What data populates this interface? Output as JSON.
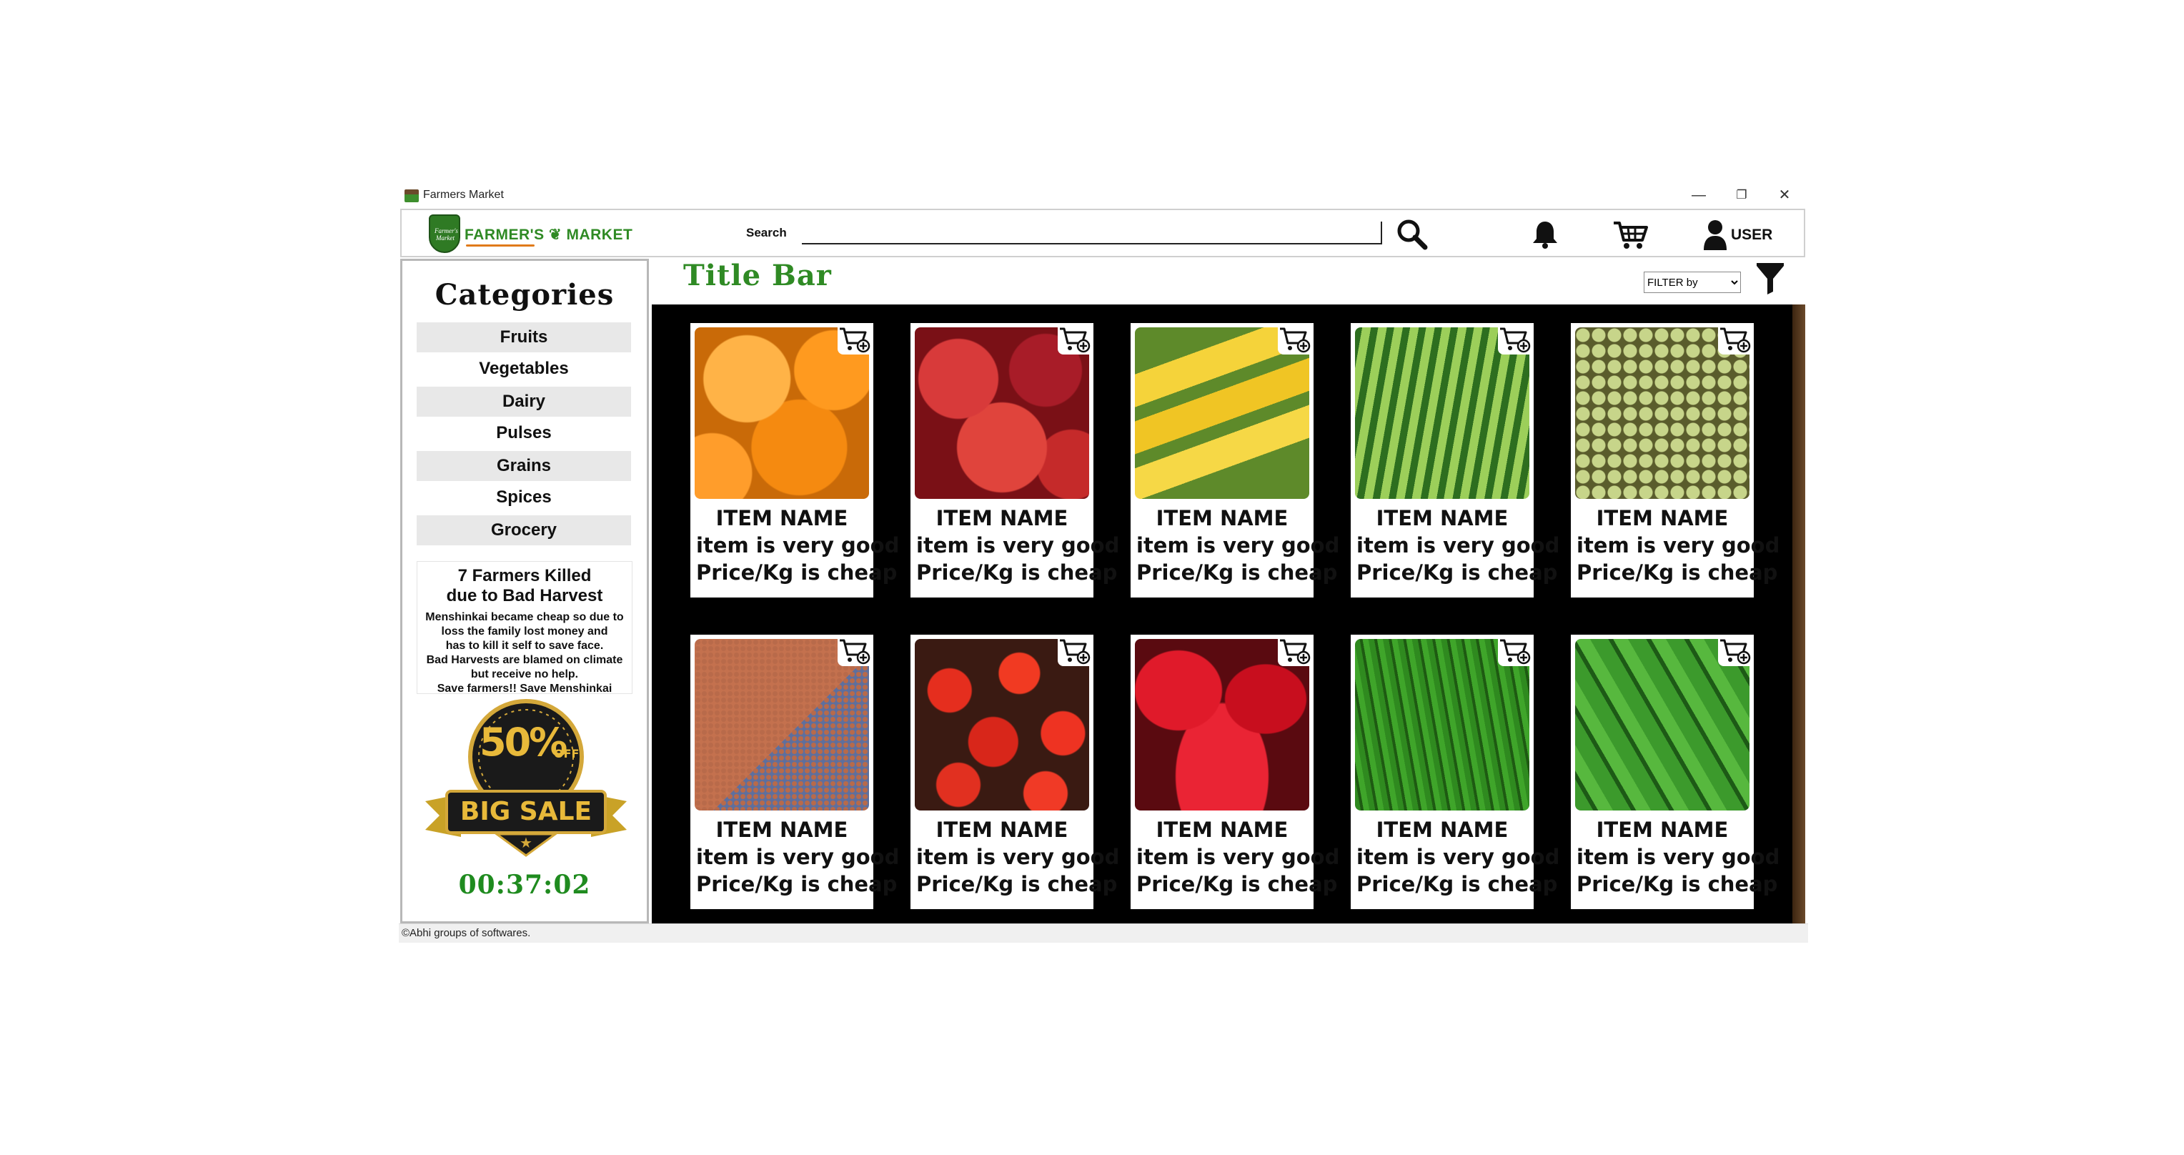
{
  "window": {
    "title": "Farmers Market",
    "controls": {
      "minimize": "—",
      "restore": "❐",
      "close": "✕"
    }
  },
  "header": {
    "logo_text": "FARMER'S",
    "logo_text2": "MARKET",
    "logo_badge": "Farmer's Market",
    "search_label": "Search",
    "search_value": "",
    "user_label": "USER",
    "icons": [
      "search-icon",
      "bell-icon",
      "cart-icon",
      "user-icon"
    ]
  },
  "sidebar": {
    "title": "Categories",
    "items": [
      {
        "label": "Fruits"
      },
      {
        "label": "Vegetables"
      },
      {
        "label": "Dairy"
      },
      {
        "label": "Pulses"
      },
      {
        "label": "Grains"
      },
      {
        "label": "Spices"
      },
      {
        "label": "Grocery"
      }
    ],
    "news": {
      "headline_1": "7 Farmers Killed",
      "headline_2": "due to Bad Harvest",
      "body": [
        "Menshinkai became cheap so due to",
        "loss the family lost money and",
        "has to kill it self to save face.",
        "Bad Harvests are blamed on climate",
        "but receive no help.",
        "Save farmers!! Save Menshinkai"
      ]
    },
    "sale": {
      "percent": "50%",
      "off": "OFF",
      "label": "BIG SALE"
    },
    "timer": "00:37:02"
  },
  "main": {
    "title": "Title Bar",
    "filter_placeholder": "FILTER by",
    "items": [
      {
        "name": "ITEM NAME",
        "desc": "item is very good",
        "price": "Price/Kg is cheap",
        "image": "oranges"
      },
      {
        "name": "ITEM NAME",
        "desc": "item is very good",
        "price": "Price/Kg is cheap",
        "image": "pomegranates"
      },
      {
        "name": "ITEM NAME",
        "desc": "item is very good",
        "price": "Price/Kg is cheap",
        "image": "bananas"
      },
      {
        "name": "ITEM NAME",
        "desc": "item is very good",
        "price": "Price/Kg is cheap",
        "image": "watermelons"
      },
      {
        "name": "ITEM NAME",
        "desc": "item is very good",
        "price": "Price/Kg is cheap",
        "image": "grapes"
      },
      {
        "name": "ITEM NAME",
        "desc": "item is very good",
        "price": "Price/Kg is cheap",
        "image": "millet"
      },
      {
        "name": "ITEM NAME",
        "desc": "item is very good",
        "price": "Price/Kg is cheap",
        "image": "tomatoes"
      },
      {
        "name": "ITEM NAME",
        "desc": "item is very good",
        "price": "Price/Kg is cheap",
        "image": "red-peppers"
      },
      {
        "name": "ITEM NAME",
        "desc": "item is very good",
        "price": "Price/Kg is cheap",
        "image": "green-chilies"
      },
      {
        "name": "ITEM NAME",
        "desc": "item is very good",
        "price": "Price/Kg is cheap",
        "image": "cucumbers"
      }
    ]
  },
  "footer": {
    "text": "©Abhi groups of softwares."
  },
  "colors": {
    "brand_green": "#2f8a24",
    "timer_green": "#1f8b1f",
    "grid_bg": "#000000",
    "accent_orange": "#e07a1a"
  }
}
